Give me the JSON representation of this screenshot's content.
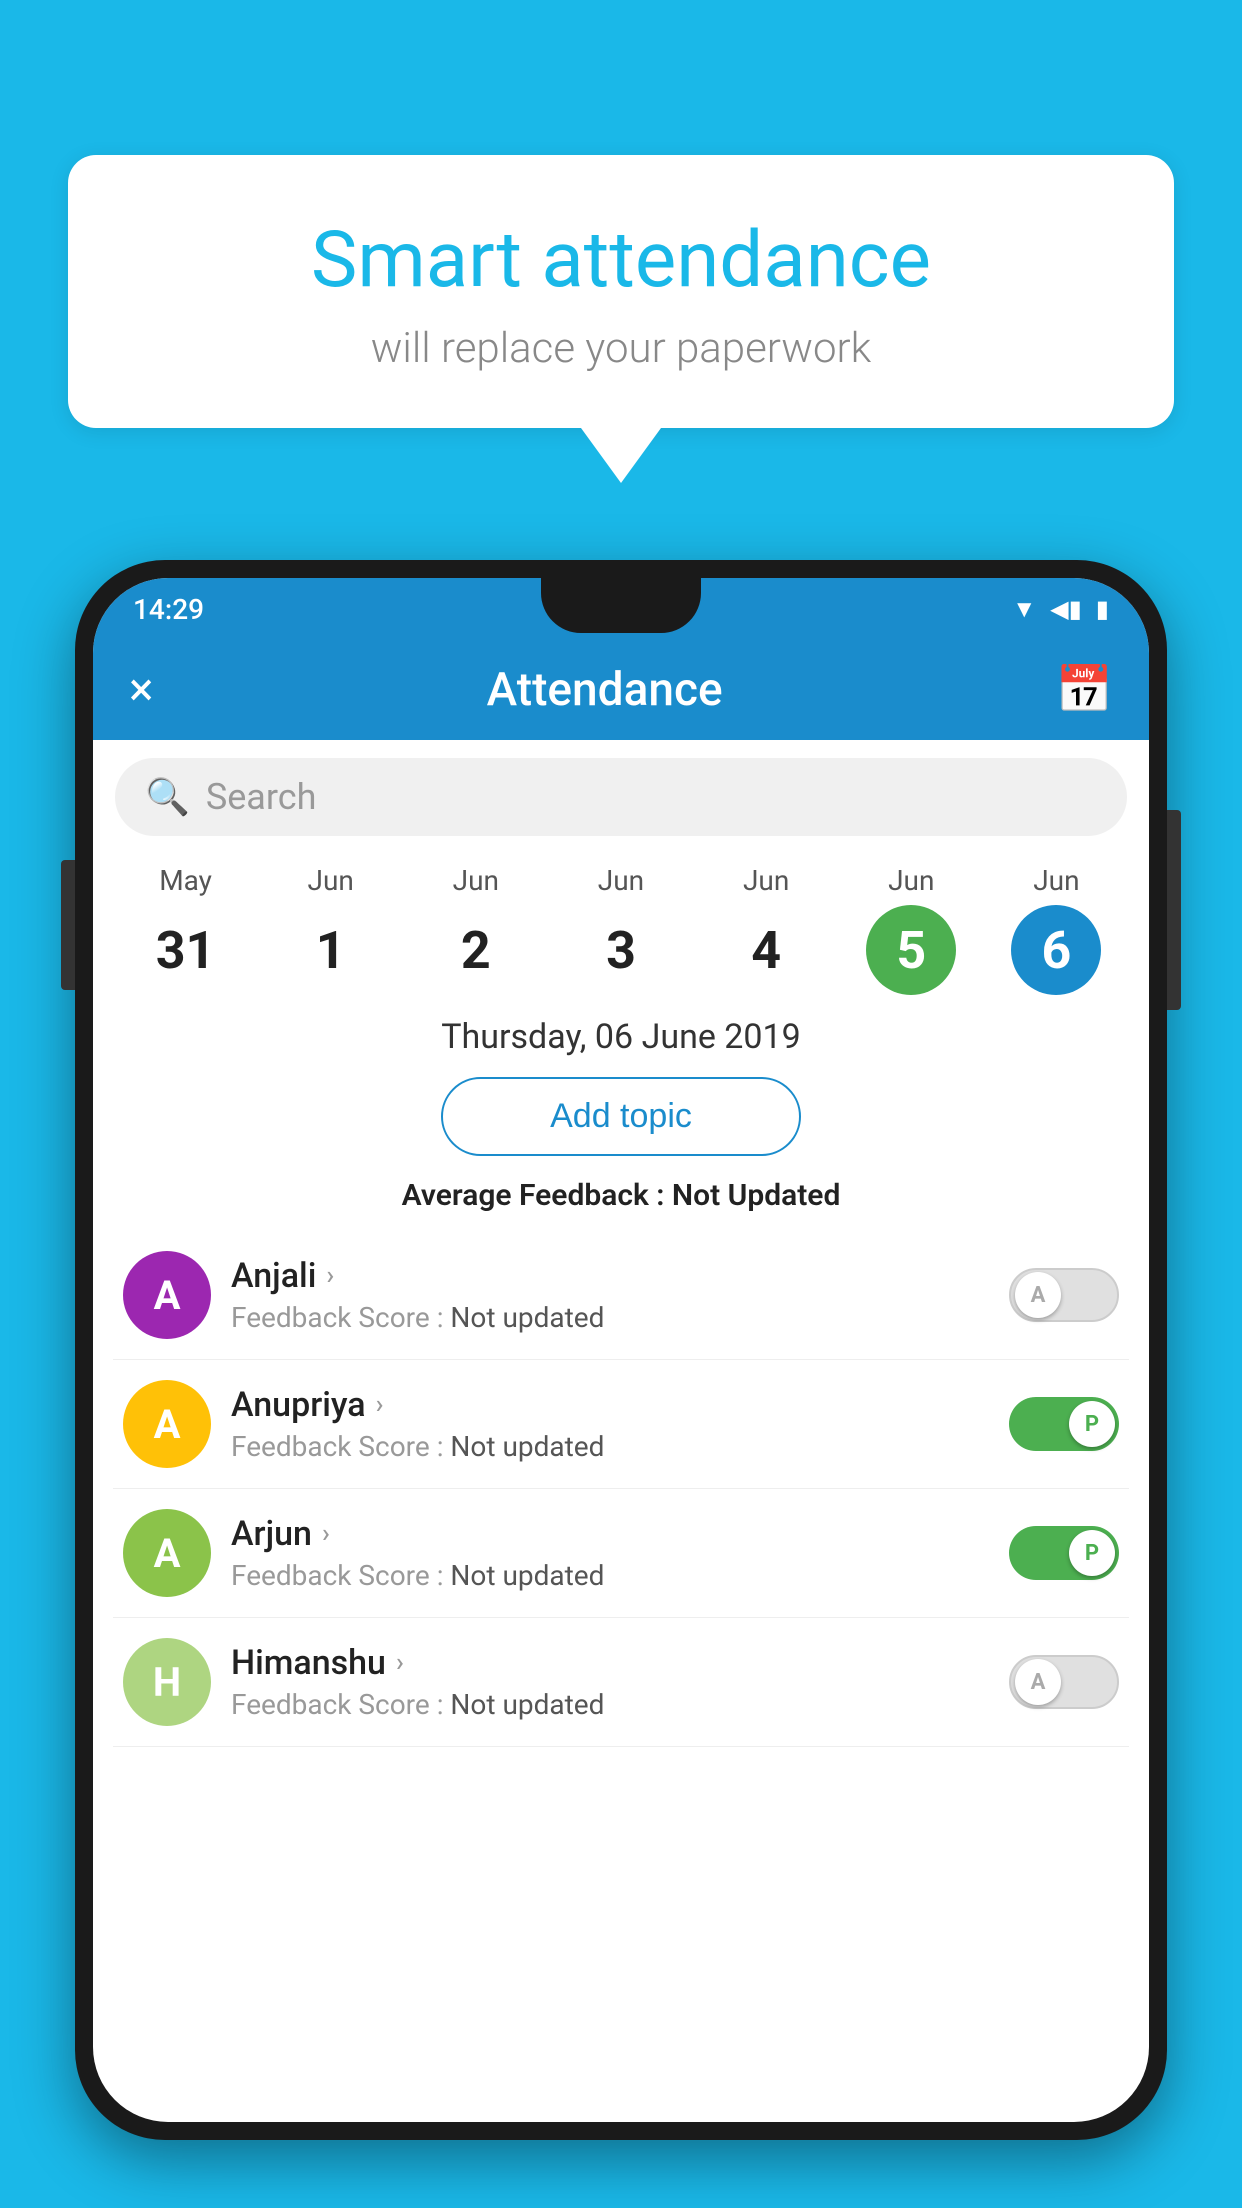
{
  "background_color": "#1ab8e8",
  "speech_bubble": {
    "title": "Smart attendance",
    "subtitle": "will replace your paperwork"
  },
  "status_bar": {
    "time": "14:29",
    "wifi_icon": "▼",
    "signal_icon": "◀",
    "battery_icon": "▮"
  },
  "app_bar": {
    "title": "Attendance",
    "close_label": "×",
    "calendar_label": "📅"
  },
  "search": {
    "placeholder": "Search"
  },
  "calendar": {
    "days": [
      {
        "month": "May",
        "date": "31",
        "type": "normal"
      },
      {
        "month": "Jun",
        "date": "1",
        "type": "normal"
      },
      {
        "month": "Jun",
        "date": "2",
        "type": "normal"
      },
      {
        "month": "Jun",
        "date": "3",
        "type": "normal"
      },
      {
        "month": "Jun",
        "date": "4",
        "type": "normal"
      },
      {
        "month": "Jun",
        "date": "5",
        "type": "today"
      },
      {
        "month": "Jun",
        "date": "6",
        "type": "selected"
      }
    ]
  },
  "selected_date_label": "Thursday, 06 June 2019",
  "add_topic_label": "Add topic",
  "avg_feedback_label": "Average Feedback : ",
  "avg_feedback_value": "Not Updated",
  "students": [
    {
      "name": "Anjali",
      "feedback_label": "Feedback Score : ",
      "feedback_value": "Not updated",
      "avatar_color": "#9c27b0",
      "avatar_letter": "A",
      "toggle_state": "off",
      "toggle_label": "A"
    },
    {
      "name": "Anupriya",
      "feedback_label": "Feedback Score : ",
      "feedback_value": "Not updated",
      "avatar_color": "#ffc107",
      "avatar_letter": "A",
      "toggle_state": "on",
      "toggle_label": "P"
    },
    {
      "name": "Arjun",
      "feedback_label": "Feedback Score : ",
      "feedback_value": "Not updated",
      "avatar_color": "#8bc34a",
      "avatar_letter": "A",
      "toggle_state": "on",
      "toggle_label": "P"
    },
    {
      "name": "Himanshu",
      "feedback_label": "Feedback Score : ",
      "feedback_value": "Not updated",
      "avatar_color": "#aed581",
      "avatar_letter": "H",
      "toggle_state": "off",
      "toggle_label": "A"
    }
  ]
}
